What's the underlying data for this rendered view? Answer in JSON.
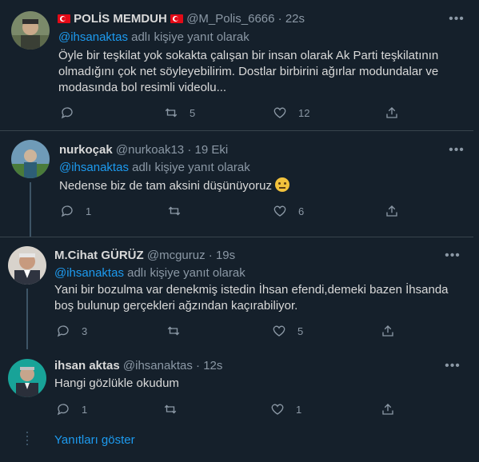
{
  "tweets": [
    {
      "name": "POLİS MEMDUH",
      "handle": "@M_Polis_6666",
      "dot": "·",
      "time": "22s",
      "reply_mention": "@ihsanaktas",
      "reply_suffix": "adlı kişiye yanıt olarak",
      "text": "Öyle bir teşkilat yok sokakta çalışan bir insan olarak Ak Parti teşkilatının olmadığını çok net söyleyebilirim. Dostlar birbirini ağırlar modundalar ve modasında bol resimli videolu...",
      "replies": "",
      "retweets": "5",
      "likes": "12"
    },
    {
      "name": "nurkoçak",
      "handle": "@nurkoak13",
      "dot": "·",
      "time": "19 Eki",
      "reply_mention": "@ihsanaktas",
      "reply_suffix": "adlı kişiye yanıt olarak",
      "text": "Nedense biz de tam aksini düşünüyoruz",
      "replies": "1",
      "retweets": "",
      "likes": "6"
    },
    {
      "name": "M.Cihat GÜRÜZ",
      "handle": "@mcguruz",
      "dot": "·",
      "time": "19s",
      "reply_mention": "@ihsanaktas",
      "reply_suffix": "adlı kişiye yanıt olarak",
      "text": "Yani bir bozulma var denekmiş istedin İhsan efendi,demeki bazen İhsanda boş bulunup gerçekleri ağzından kaçırabiliyor.",
      "replies": "3",
      "retweets": "",
      "likes": "5"
    },
    {
      "name": "ihsan aktas",
      "handle": "@ihsanaktas",
      "dot": "·",
      "time": "12s",
      "text": "Hangi gözlükle okudum",
      "replies": "1",
      "retweets": "",
      "likes": "1"
    }
  ],
  "show_replies": "Yanıtları göster",
  "icons": {
    "reply": "reply-icon",
    "retweet": "retweet-icon",
    "like": "heart-icon",
    "share": "share-icon",
    "more": "more-icon"
  },
  "colors": {
    "background": "#15202b",
    "accent": "#1d9bf0",
    "muted": "#8b98a5",
    "divider": "#38444d"
  }
}
